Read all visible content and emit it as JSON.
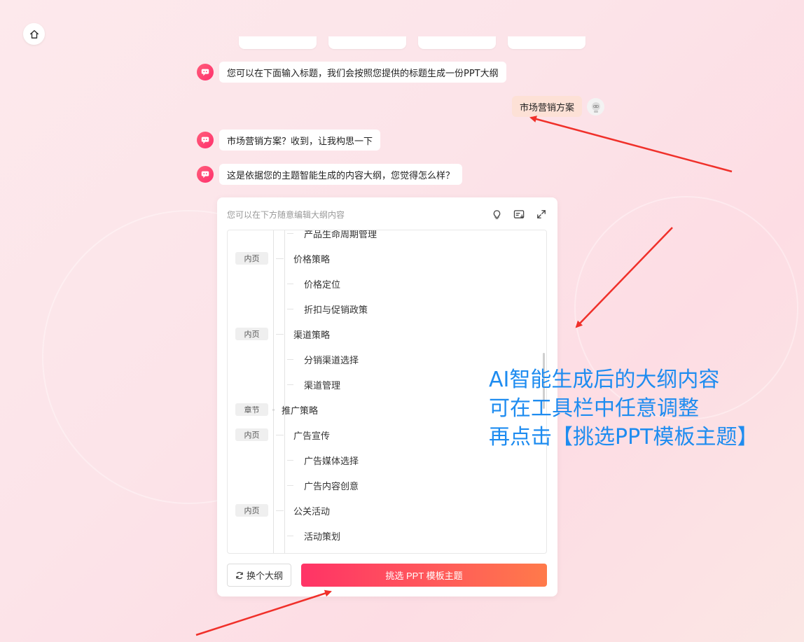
{
  "messages": [
    {
      "role": "bot",
      "text": "您可以在下面输入标题，我们会按照您提供的标题生成一份PPT大纲"
    },
    {
      "role": "user",
      "text": "市场营销方案"
    },
    {
      "role": "bot",
      "text": "市场营销方案？收到，让我构思一下"
    },
    {
      "role": "bot",
      "text": "这是依据您的主题智能生成的内容大纲，您觉得怎么样？"
    }
  ],
  "outline": {
    "hint": "您可以在下方随意编辑大纲内容",
    "tools": [
      "bulb-icon",
      "format-list-icon",
      "expand-icon"
    ],
    "nodes": [
      {
        "tag": "",
        "level": 3,
        "text": "产品生命周期管理"
      },
      {
        "tag": "内页",
        "level": 2,
        "text": "价格策略"
      },
      {
        "tag": "",
        "level": 3,
        "text": "价格定位"
      },
      {
        "tag": "",
        "level": 3,
        "text": "折扣与促销政策"
      },
      {
        "tag": "内页",
        "level": 2,
        "text": "渠道策略"
      },
      {
        "tag": "",
        "level": 3,
        "text": "分销渠道选择"
      },
      {
        "tag": "",
        "level": 3,
        "text": "渠道管理"
      },
      {
        "tag": "章节",
        "level": 1,
        "text": "推广策略"
      },
      {
        "tag": "内页",
        "level": 2,
        "text": "广告宣传"
      },
      {
        "tag": "",
        "level": 3,
        "text": "广告媒体选择"
      },
      {
        "tag": "",
        "level": 3,
        "text": "广告内容创意"
      },
      {
        "tag": "内页",
        "level": 2,
        "text": "公关活动"
      },
      {
        "tag": "",
        "level": 3,
        "text": "活动策划"
      }
    ],
    "change_label": "换个大纲",
    "pick_label": "挑选 PPT 模板主题"
  },
  "annotation": {
    "lines": [
      "AI智能生成后的大纲内容",
      "可在工具栏中任意调整",
      "再点击【挑选PPT模板主题】"
    ],
    "color": "#1e8cf0"
  },
  "colors": {
    "accent_start": "#ff3366",
    "accent_end": "#ff7a4a",
    "arrow": "#f0302a"
  }
}
